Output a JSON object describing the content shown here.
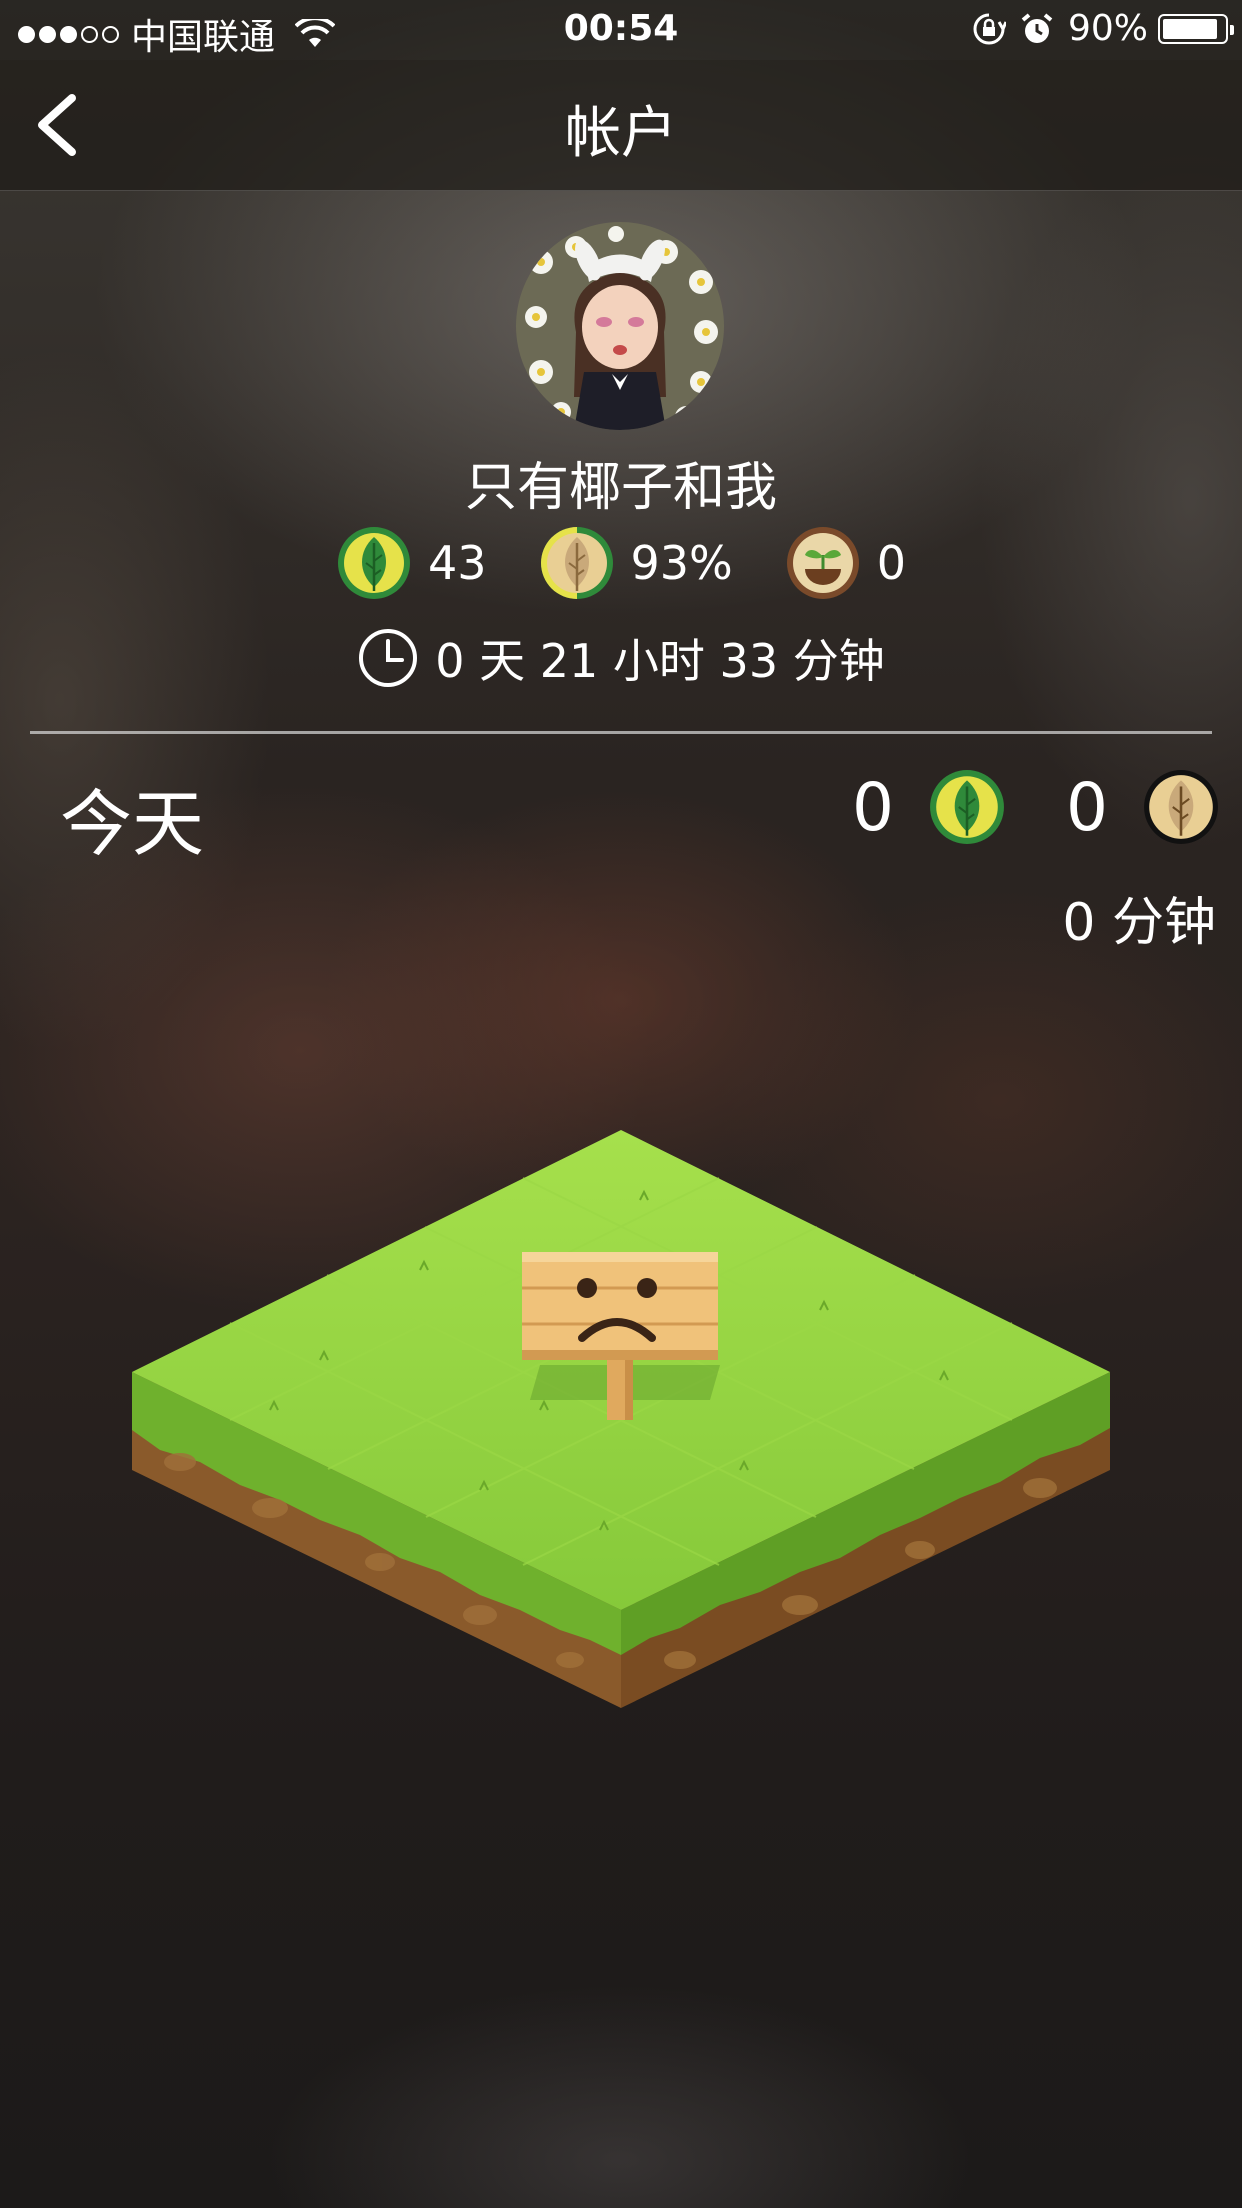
{
  "status_bar": {
    "carrier": "中国联通",
    "signal_bars_filled": 3,
    "signal_bars_total": 5,
    "time": "00:54",
    "battery_percent": "90%",
    "battery_level": 0.9,
    "icons": [
      "wifi-icon",
      "rotation-lock-icon",
      "alarm-icon",
      "battery-icon"
    ]
  },
  "nav": {
    "title": "帐户",
    "back_icon": "chevron-left-icon"
  },
  "profile": {
    "username": "只有椰子和我",
    "stats": [
      {
        "icon": "healthy-tree-icon",
        "value": "43"
      },
      {
        "icon": "success-rate-leaf-icon",
        "value": "93%"
      },
      {
        "icon": "sapling-pot-icon",
        "value": "0"
      }
    ],
    "total_time": "0 天 21 小时 33 分钟"
  },
  "today": {
    "label": "今天",
    "healthy_count": "0",
    "withered_count": "0",
    "minutes": "0 分钟"
  },
  "colors": {
    "leaf_green": "#2f8a3a",
    "leaf_ring": "#e6e24a",
    "withered_leaf": "#c9a97a",
    "grass": "#8fd13a",
    "dirt": "#8a5a2b",
    "sign": "#f0c27a"
  }
}
